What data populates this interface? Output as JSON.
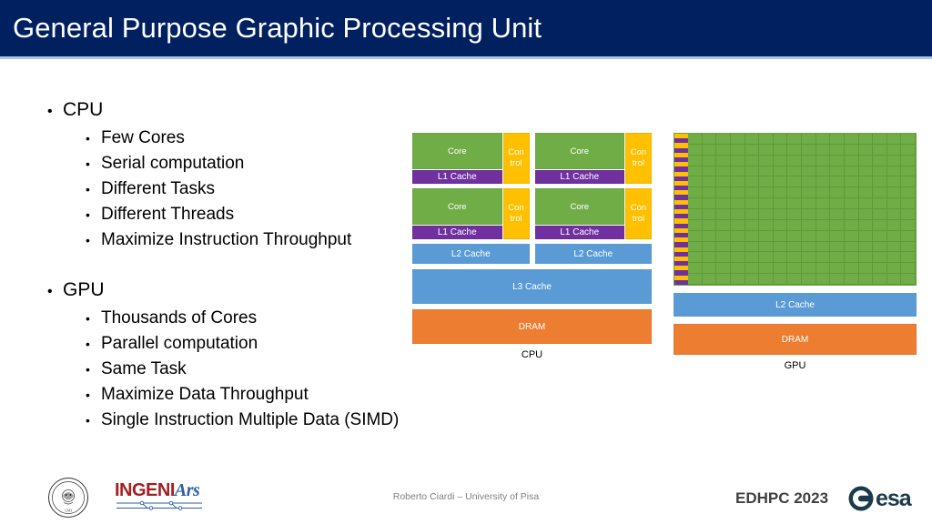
{
  "header": {
    "title": "General Purpose Graphic Processing Unit"
  },
  "content": {
    "bullets": [
      {
        "level": 1,
        "label": "CPU",
        "children": [
          "Few Cores",
          "Serial computation",
          "Different Tasks",
          "Different Threads",
          "Maximize Instruction Throughput"
        ]
      },
      {
        "level": 1,
        "label": "GPU",
        "children": [
          "Thousands of Cores",
          "Parallel computation",
          "Same Task",
          "Maximize Data Throughput",
          "Single Instruction Multiple Data (SIMD)"
        ]
      }
    ],
    "bullet_marker": "•"
  },
  "cpu_diagram": {
    "caption": "CPU",
    "core_label": "Core",
    "control_label_line1": "Con",
    "control_label_line2": "trol",
    "l1_label": "L1 Cache",
    "l2_label": "L2 Cache",
    "l3_label": "L3 Cache",
    "dram_label": "DRAM",
    "core_count": 4,
    "l2_count": 2
  },
  "gpu_diagram": {
    "caption": "GPU",
    "l2_label": "L2 Cache",
    "dram_label": "DRAM",
    "grid_columns": 16,
    "grid_rows": 14,
    "control_band_pairs": 16
  },
  "colors": {
    "header_navy": "#002060",
    "header_underline": "#a9c6e8",
    "core_green": "#70ad47",
    "control_yellow": "#ffc000",
    "cache_purple": "#7030a0",
    "cache_blue": "#5b9bd5",
    "dram_orange": "#ed7d31",
    "footer_grey": "#808080",
    "edhpc_grey": "#404040",
    "ingeniars_red": "#a32024",
    "ingeniars_blue": "#2e5fa3",
    "esa_navy": "#1b3a4b"
  },
  "footer": {
    "credit": "Roberto Ciardi – University of Pisa",
    "event": "EDHPC 2023",
    "esa_wordmark": "esa",
    "ingeniars_part1": "INGENI",
    "ingeniars_part2": "Ars",
    "unipi_motto_top": "IN SVPREMAE DIGNITATIS",
    "unipi_year": "1343"
  }
}
